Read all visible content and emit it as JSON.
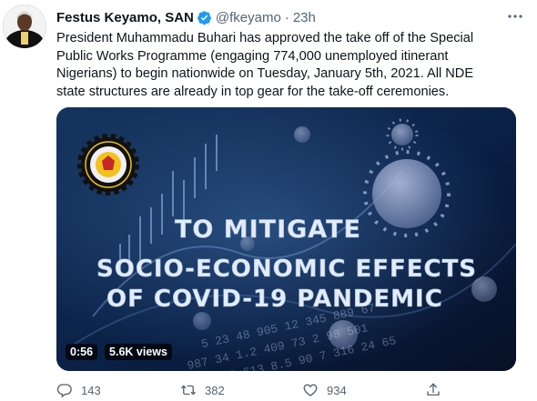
{
  "tweet": {
    "author_name": "Festus Keyamo, SAN",
    "handle": "@fkeyamo",
    "separator": "·",
    "time": "23h",
    "text": "President Muhammadu Buhari has approved the take off of the Special Public Works Programme (engaging 774,000 unemployed itinerant Nigerians) to begin nationwide on Tuesday, January 5th, 2021. All NDE state structures are already in top gear for the take-off ceremonies.",
    "video": {
      "headline_1": "TO MITIGATE",
      "headline_2": "SOCIO-ECONOMIC EFFECTS",
      "headline_3": "OF COVID-19 PANDEMIC",
      "duration": "0:56",
      "views": "5.6K views"
    },
    "actions": {
      "replies": "143",
      "retweets": "382",
      "likes": "934"
    }
  },
  "colors": {
    "verified": "#1d9bf0",
    "text_secondary": "#536471",
    "video_bg": "#06112a"
  }
}
